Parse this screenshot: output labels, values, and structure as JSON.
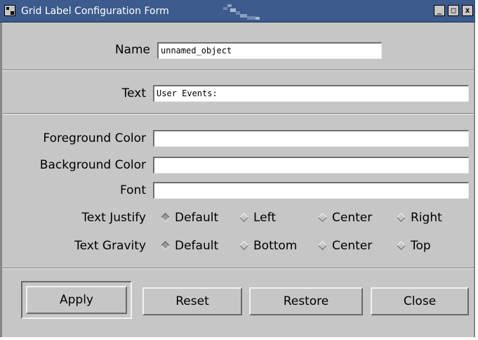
{
  "window": {
    "title": "Grid Label Configuration Form",
    "controls": {
      "minimize": "_",
      "maximize": "□",
      "close": "x"
    }
  },
  "form": {
    "name": {
      "label": "Name",
      "value": "unnamed_object"
    },
    "text": {
      "label": "Text",
      "value": "User Events:"
    },
    "foreground_color": {
      "label": "Foreground Color",
      "value": ""
    },
    "background_color": {
      "label": "Background Color",
      "value": ""
    },
    "font": {
      "label": "Font",
      "value": ""
    },
    "text_justify": {
      "label": "Text Justify",
      "options": [
        "Default",
        "Left",
        "Center",
        "Right"
      ],
      "selected": "Default"
    },
    "text_gravity": {
      "label": "Text Gravity",
      "options": [
        "Default",
        "Bottom",
        "Center",
        "Top"
      ],
      "selected": "Default"
    }
  },
  "buttons": {
    "apply": "Apply",
    "reset": "Reset",
    "restore": "Restore",
    "close": "Close"
  },
  "colors": {
    "titlebar": "#3d5b8c",
    "panel": "#c6c6c6",
    "field": "#ffffff"
  }
}
